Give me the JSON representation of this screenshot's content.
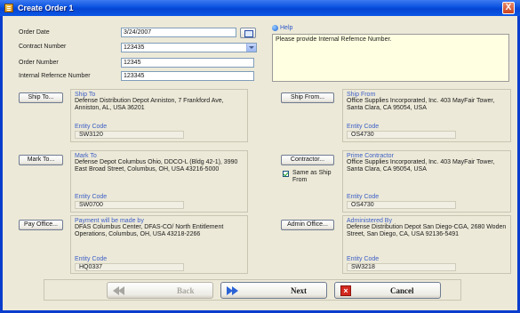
{
  "window": {
    "title": "Create Order 1",
    "close_glyph": "X"
  },
  "form": {
    "order_date": {
      "label": "Order Date",
      "value": "3/24/2007"
    },
    "contract_number": {
      "label": "Contract Number",
      "value": "123435"
    },
    "order_number": {
      "label": "Order Number",
      "value": "12345"
    },
    "internal_reference": {
      "label": "Internal Refernce Number",
      "value": "123345"
    }
  },
  "help": {
    "label": "Help",
    "text": "Please provide Internal Refernce Number."
  },
  "ship_to": {
    "button": "Ship To...",
    "title": "Ship To",
    "text": "Defense Distribution Depot Anniston, 7 Frankford Ave, Anniston, AL, USA 36201",
    "entity_code_label": "Entity Code",
    "entity_code": "SW3120"
  },
  "ship_from": {
    "button": "Ship From...",
    "title": "Ship From",
    "text": "Office Supplies Incorporated, Inc. 403 MayFair Tower, Santa Clara, CA 95054, USA",
    "entity_code_label": "Entity Code",
    "entity_code": "OS4730"
  },
  "mark_to": {
    "button": "Mark To...",
    "title": "Mark To",
    "text": "Defense Depot Columbus Ohio, DDCO-L (Bldg 42-1), 3990 East Broad Street, Columbus, OH, USA 43216-5000",
    "entity_code_label": "Entity Code",
    "entity_code": "SW0700"
  },
  "contractor": {
    "button": "Contractor...",
    "checkbox_label": "Same as Ship From",
    "checked": true,
    "title": "Prime Contractor",
    "text": "Office Supplies Incorporated, Inc. 403 MayFair Tower, Santa Clara, CA 95054, USA",
    "entity_code_label": "Entity Code",
    "entity_code": "OS4730"
  },
  "pay_office": {
    "button": "Pay Office...",
    "title": "Payment will be made by",
    "text": "DFAS Columbus Center, DFAS-CO/ North Entitlement Operations, Columbus, OH, USA 43218-2266",
    "entity_code_label": "Entity Code",
    "entity_code": "HQ0337"
  },
  "admin_office": {
    "button": "Admin Office...",
    "title": "Administered By",
    "text": "Defense Distribution Depot San Diego-CGA, 2680 Woden Street, San Diego, CA, USA 92136-5491",
    "entity_code_label": "Entity Code",
    "entity_code": "SW3218"
  },
  "footer": {
    "back": "Back",
    "next": "Next",
    "cancel": "Cancel"
  },
  "colors": {
    "title_bar": "#0a52e0",
    "help_background": "#ffffe1",
    "link_blue": "#3d5fc6",
    "cancel_red": "#d3281e"
  },
  "icons": [
    "app-icon",
    "close-icon",
    "calendar-icon",
    "dropdown-arrow-icon",
    "help-icon",
    "checkbox-icon",
    "back-arrow-icon",
    "next-arrow-icon",
    "cancel-x-icon"
  ]
}
